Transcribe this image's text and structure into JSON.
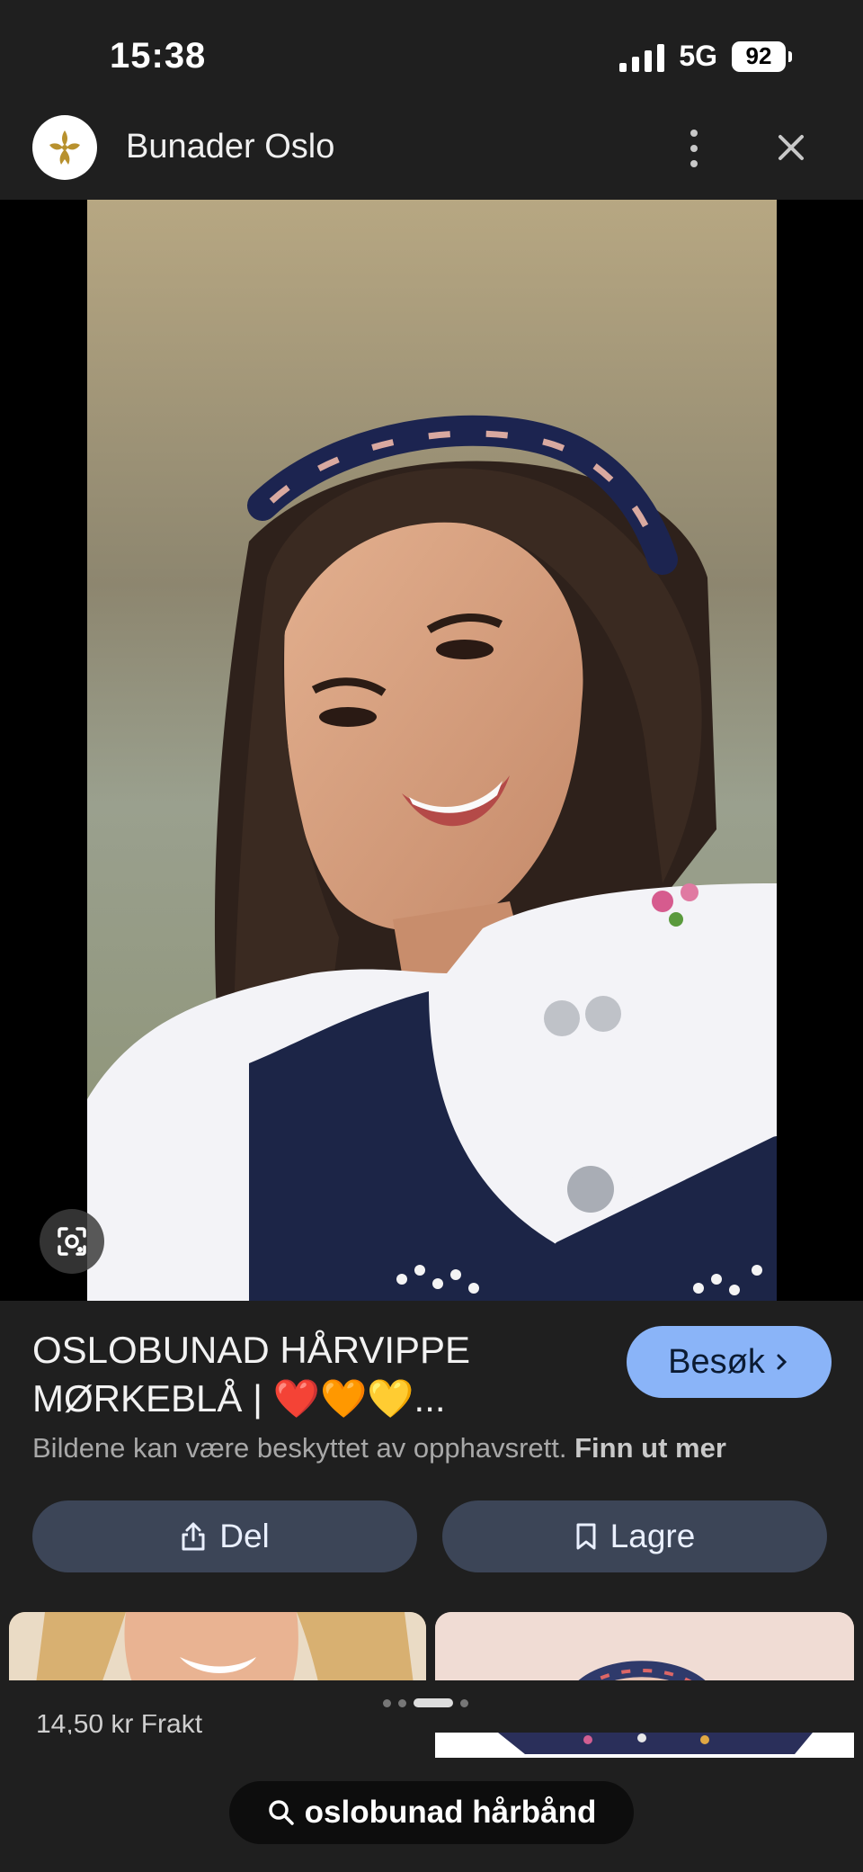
{
  "status_bar": {
    "time": "15:38",
    "network": "5G",
    "battery": "92"
  },
  "header": {
    "site_name": "Bunader Oslo",
    "logo_icon": "bunader-oslo-logo",
    "more_icon": "more-vert-icon",
    "close_icon": "close-icon"
  },
  "result": {
    "title_line1": "OSLOBUNAD HÅRVIPPE",
    "title_line2": "MØRKEBLÅ | ❤️🧡💛...",
    "visit_label": "Besøk",
    "copyright_text": "Bildene kan være beskyttet av opphavsrett.",
    "learn_more": "Finn ut mer"
  },
  "actions": {
    "share_label": "Del",
    "save_label": "Lagre"
  },
  "related": {
    "peek_text": "14,50 kr Frakt"
  },
  "search": {
    "query": "oslobunad hårbånd"
  },
  "colors": {
    "accent_button": "#8ab4f8",
    "action_button": "#3c4557",
    "background": "#1f1f1f"
  }
}
